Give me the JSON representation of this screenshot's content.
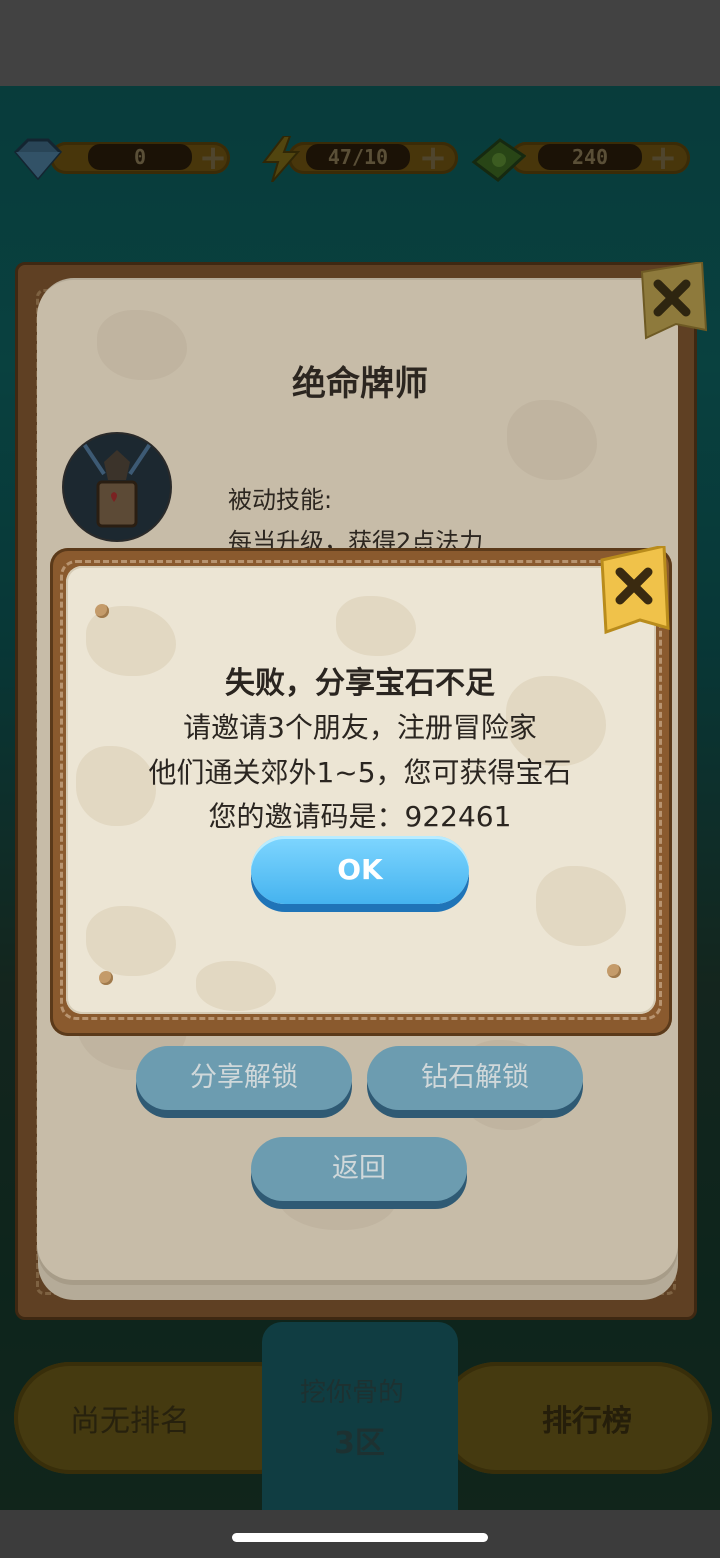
{
  "resources": [
    {
      "icon": "diamond-icon",
      "value": "0"
    },
    {
      "icon": "energy-icon",
      "value": "47/10"
    },
    {
      "icon": "cash-icon",
      "value": "240"
    }
  ],
  "card": {
    "title": "绝命牌师",
    "skill_label": "被动技能:",
    "skill_desc": "每当升级，获得2点法力",
    "share_unlock": "分享解锁",
    "diamond_unlock": "钻石解锁",
    "back": "返回"
  },
  "background": {
    "rank_text": "尚无排名",
    "stage_line1": "挖你骨的",
    "stage_line2": "3区",
    "leaderboard": "排行榜"
  },
  "dialog": {
    "title": "失败，分享宝石不足",
    "line1": "请邀请3个朋友，注册冒险家",
    "line2": "他们通关郊外1~5，您可获得宝石",
    "line3": "您的邀请码是：922461",
    "ok": "OK"
  },
  "colors": {
    "ok_button": "#45b3ef",
    "dialog_bg": "#ece5d4",
    "frame_wood": "#8a5a2e"
  }
}
